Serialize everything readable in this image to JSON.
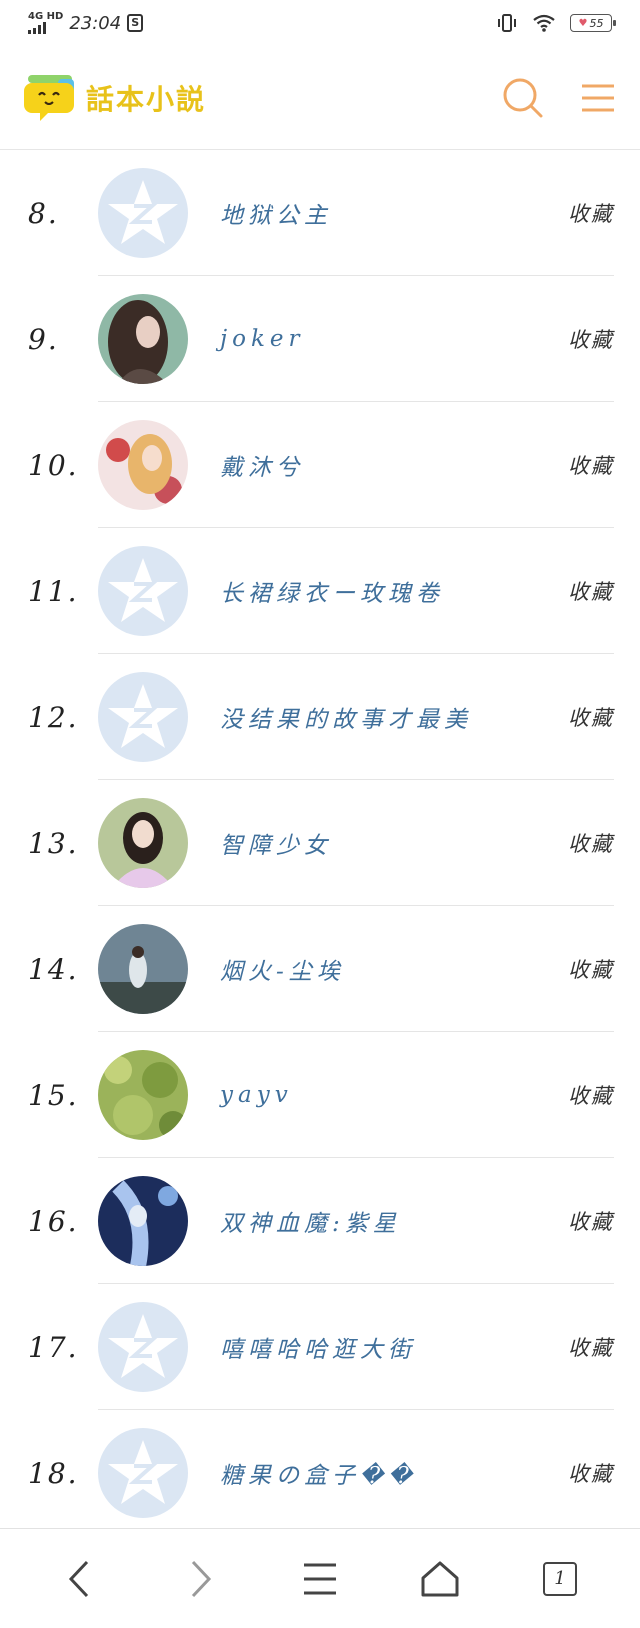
{
  "status_bar": {
    "network": "4G HD",
    "time": "23:04",
    "sim_badge": "S",
    "battery": "55",
    "icons": [
      "signal-icon",
      "vibrate-icon",
      "wifi-icon",
      "battery-icon"
    ]
  },
  "header": {
    "app_name": "話本小説",
    "logo_icon": "speech-bubble-logo-icon",
    "search_icon": "search-icon",
    "menu_icon": "hamburger-menu-icon",
    "accent_color": "#f0a866",
    "logo_color": "#e8c21a"
  },
  "list": {
    "collect_label": "收藏",
    "title_color": "#3f6f9b",
    "items": [
      {
        "rank": "8.",
        "title": "地狱公主",
        "avatar": "default-q-avatar"
      },
      {
        "rank": "9.",
        "title": "joker",
        "avatar": "photo-curly-hair-girl"
      },
      {
        "rank": "10.",
        "title": "戴沐兮",
        "avatar": "photo-anime-girl-flowers"
      },
      {
        "rank": "11.",
        "title": "长裙绿衣ー玫瑰卷",
        "avatar": "default-q-avatar"
      },
      {
        "rank": "12.",
        "title": "没结果的故事才最美",
        "avatar": "default-q-avatar"
      },
      {
        "rank": "13.",
        "title": "智障少女",
        "avatar": "photo-girl-pink-sweater"
      },
      {
        "rank": "14.",
        "title": "烟火-尘埃",
        "avatar": "photo-girl-seaside"
      },
      {
        "rank": "15.",
        "title": "yayv",
        "avatar": "photo-green-field"
      },
      {
        "rank": "16.",
        "title": "双神血魔:紫星",
        "avatar": "photo-anime-blue-hair"
      },
      {
        "rank": "17.",
        "title": "嘻嘻哈哈逛大街",
        "avatar": "default-q-avatar"
      },
      {
        "rank": "18.",
        "title": "糖果の盒子��",
        "avatar": "default-q-avatar"
      }
    ]
  },
  "bottom_nav": {
    "back_icon": "back-arrow-icon",
    "forward_icon": "forward-arrow-icon",
    "menu_icon": "menu-icon",
    "home_icon": "home-icon",
    "tabs_count": "1"
  }
}
